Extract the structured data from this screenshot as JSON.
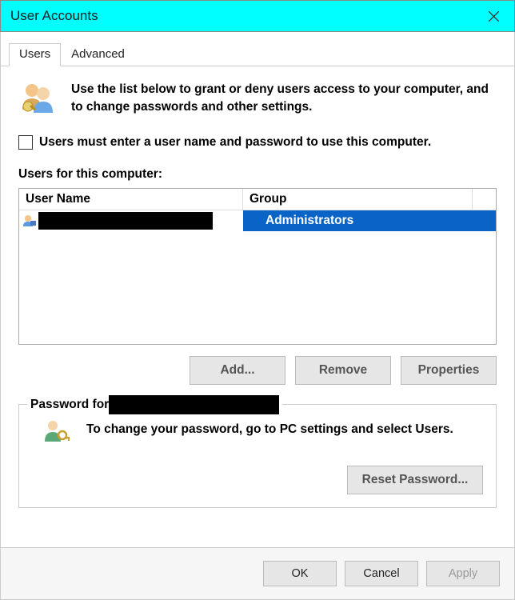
{
  "window": {
    "title": "User Accounts"
  },
  "tabs": {
    "users": "Users",
    "advanced": "Advanced"
  },
  "intro": {
    "text": "Use the list below to grant or deny users access to your computer, and to change passwords and other settings."
  },
  "checkbox": {
    "label": "Users must enter a user name and password to use this computer.",
    "checked": false
  },
  "list": {
    "label": "Users for this computer:",
    "columns": {
      "name": "User Name",
      "group": "Group"
    },
    "rows": [
      {
        "name_redacted": true,
        "group": "Administrators",
        "selected": true
      }
    ]
  },
  "buttons": {
    "add": "Add...",
    "remove": "Remove",
    "properties": "Properties"
  },
  "password_section": {
    "legend_prefix": "Password for",
    "legend_redacted": true,
    "message": "To change your password, go to PC settings and select Users.",
    "reset_button": "Reset Password..."
  },
  "footer": {
    "ok": "OK",
    "cancel": "Cancel",
    "apply": "Apply"
  }
}
